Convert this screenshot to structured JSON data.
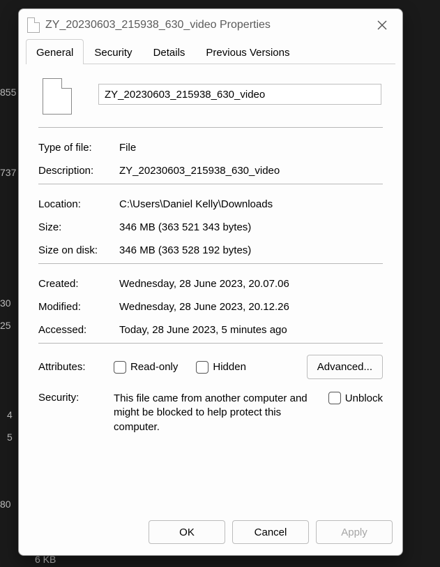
{
  "window": {
    "title": "ZY_20230603_215938_630_video Properties"
  },
  "tabs": {
    "general": "General",
    "security": "Security",
    "details": "Details",
    "previous_versions": "Previous Versions"
  },
  "file": {
    "name_value": "ZY_20230603_215938_630_video"
  },
  "labels": {
    "type_of_file": "Type of file:",
    "description": "Description:",
    "location": "Location:",
    "size": "Size:",
    "size_on_disk": "Size on disk:",
    "created": "Created:",
    "modified": "Modified:",
    "accessed": "Accessed:",
    "attributes": "Attributes:",
    "security": "Security:"
  },
  "values": {
    "type_of_file": "File",
    "description": "ZY_20230603_215938_630_video",
    "location": "C:\\Users\\Daniel Kelly\\Downloads",
    "size": "346 MB (363 521 343 bytes)",
    "size_on_disk": "346 MB (363 528 192 bytes)",
    "created": "Wednesday, 28 June 2023, 20.07.06",
    "modified": "Wednesday, 28 June 2023, 20.12.26",
    "accessed": "Today, 28 June 2023, 5 minutes ago"
  },
  "attributes": {
    "read_only_label": "Read-only",
    "hidden_label": "Hidden",
    "advanced_label": "Advanced..."
  },
  "security": {
    "message": "This file came from another computer and might be blocked to help protect this computer.",
    "unblock_label": "Unblock"
  },
  "buttons": {
    "ok": "OK",
    "cancel": "Cancel",
    "apply": "Apply"
  },
  "background_fragments": {
    "a": "855",
    "b": "737",
    "c": "30",
    "d": "25",
    "e": "4",
    "f": "5",
    "g": "80",
    "h": "6 KB"
  }
}
